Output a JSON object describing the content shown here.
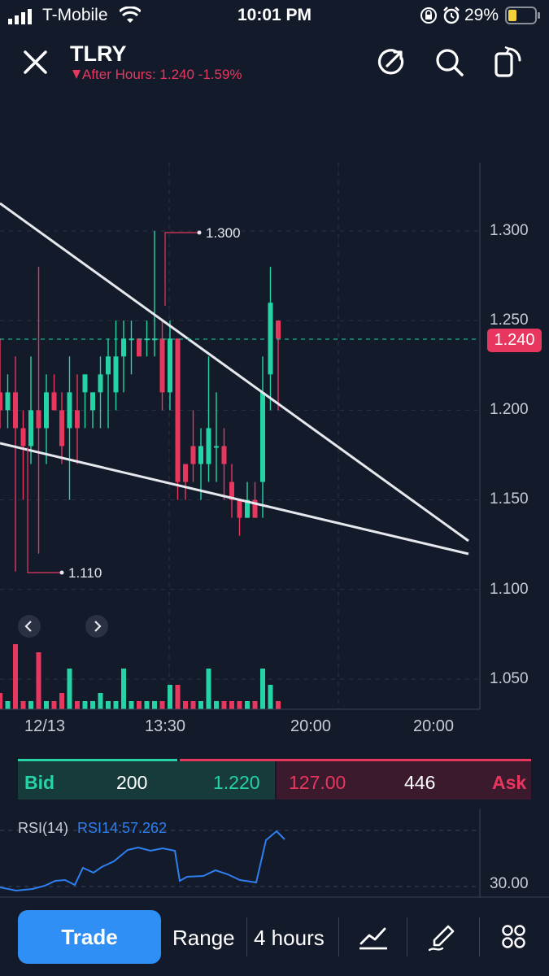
{
  "status_bar": {
    "carrier": "T-Mobile",
    "time": "10:01 PM",
    "battery": "29%"
  },
  "header": {
    "ticker": "TLRY",
    "after_hours": "After Hours: 1.240 -1.59%"
  },
  "chart": {
    "y_ticks": [
      "1.300",
      "1.250",
      "1.200",
      "1.150",
      "1.100",
      "1.050"
    ],
    "x_ticks": [
      "12/13",
      "13:30",
      "20:00",
      "20:00"
    ],
    "current_price": "1.240",
    "high_label": "1.300",
    "low_label": "1.110"
  },
  "bid_ask": {
    "bid_label": "Bid",
    "bid_size": "200",
    "bid_price": "1.220",
    "ask_price": "127.00",
    "ask_size": "446",
    "ask_label": "Ask"
  },
  "rsi": {
    "label": "RSI(14)",
    "value": "RSI14:57.262",
    "level": "30.00"
  },
  "toolbar": {
    "trade": "Trade",
    "range": "Range",
    "interval": "4 hours"
  },
  "colors": {
    "up": "#26d3a6",
    "down": "#e8375f",
    "accent": "#2f8ff5"
  },
  "chart_data": {
    "type": "candlestick",
    "ylim": [
      1.03,
      1.335
    ],
    "candles": [
      [
        1.21,
        1.24,
        1.19,
        1.2
      ],
      [
        1.2,
        1.22,
        1.19,
        1.21
      ],
      [
        1.21,
        1.23,
        1.11,
        1.19
      ],
      [
        1.19,
        1.2,
        1.15,
        1.18
      ],
      [
        1.18,
        1.23,
        1.17,
        1.2
      ],
      [
        1.2,
        1.28,
        1.12,
        1.19
      ],
      [
        1.19,
        1.22,
        1.17,
        1.21
      ],
      [
        1.21,
        1.22,
        1.2,
        1.2
      ],
      [
        1.2,
        1.21,
        1.17,
        1.18
      ],
      [
        1.19,
        1.23,
        1.15,
        1.21
      ],
      [
        1.2,
        1.22,
        1.17,
        1.19
      ],
      [
        1.21,
        1.22,
        1.19,
        1.22
      ],
      [
        1.2,
        1.21,
        1.19,
        1.21
      ],
      [
        1.21,
        1.23,
        1.19,
        1.22
      ],
      [
        1.22,
        1.24,
        1.19,
        1.23
      ],
      [
        1.21,
        1.25,
        1.2,
        1.23
      ],
      [
        1.23,
        1.25,
        1.21,
        1.24
      ],
      [
        1.24,
        1.25,
        1.22,
        1.24
      ],
      [
        1.24,
        1.24,
        1.23,
        1.23
      ],
      [
        1.24,
        1.25,
        1.23,
        1.24
      ],
      [
        1.24,
        1.3,
        1.23,
        1.24
      ],
      [
        1.24,
        1.25,
        1.2,
        1.21
      ],
      [
        1.21,
        1.25,
        1.2,
        1.24
      ],
      [
        1.24,
        1.24,
        1.15,
        1.16
      ],
      [
        1.17,
        1.17,
        1.15,
        1.16
      ],
      [
        1.18,
        1.2,
        1.16,
        1.17
      ],
      [
        1.17,
        1.19,
        1.15,
        1.18
      ],
      [
        1.17,
        1.23,
        1.16,
        1.19
      ],
      [
        1.18,
        1.21,
        1.16,
        1.18
      ],
      [
        1.18,
        1.19,
        1.15,
        1.17
      ],
      [
        1.16,
        1.17,
        1.14,
        1.15
      ],
      [
        1.15,
        1.15,
        1.13,
        1.14
      ],
      [
        1.14,
        1.16,
        1.14,
        1.15
      ],
      [
        1.15,
        1.16,
        1.14,
        1.14
      ],
      [
        1.16,
        1.23,
        1.14,
        1.21
      ],
      [
        1.22,
        1.28,
        1.2,
        1.26
      ],
      [
        1.25,
        1.25,
        1.2,
        1.24
      ]
    ],
    "volumes": [
      2,
      1,
      8,
      1,
      1,
      7,
      1,
      1,
      2,
      5,
      1,
      1,
      1,
      2,
      1,
      1,
      5,
      1,
      1,
      1,
      1,
      1,
      3,
      3,
      1,
      1,
      1,
      5,
      1,
      1,
      1,
      1,
      1,
      1,
      5,
      3,
      1
    ]
  }
}
